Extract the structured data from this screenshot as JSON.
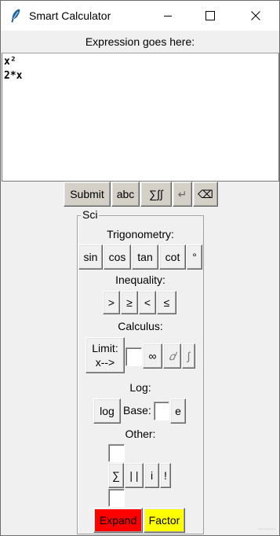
{
  "window": {
    "title": "Smart Calculator",
    "icon": "feather-icon",
    "controls": [
      "minimize-icon",
      "maximize-icon",
      "close-icon"
    ]
  },
  "expression": {
    "label": "Expression goes here:",
    "lines": [
      "x²",
      "2*x"
    ]
  },
  "toolbar": {
    "submit": "Submit",
    "abc": "abc",
    "sigma_int": "∑∫∫",
    "enter": "↵",
    "backspace": "⌫"
  },
  "sci": {
    "legend": "Sci",
    "trig": {
      "label": "Trigonometry:",
      "buttons": [
        "sin",
        "cos",
        "tan",
        "cot",
        "°"
      ]
    },
    "inequality": {
      "label": "Inequality:",
      "buttons": [
        ">",
        "≥",
        "<",
        "≤"
      ]
    },
    "calculus": {
      "label": "Calculus:",
      "limit": "Limit:\nx-->",
      "infinity": "∞",
      "derivative": "𝑑",
      "integral": "∫"
    },
    "log": {
      "label": "Log:",
      "log": "log",
      "base_label": "Base:",
      "e": "e"
    },
    "other": {
      "label": "Other:",
      "sum": "∑",
      "abs": "| |",
      "i": "i",
      "factorial": "!"
    },
    "expand": "Expand",
    "factor": "Factor"
  },
  "colors": {
    "expand": "#ff0000",
    "factor": "#ffff00",
    "gray_button": "#d4d0c8"
  },
  "watermark": "-------"
}
